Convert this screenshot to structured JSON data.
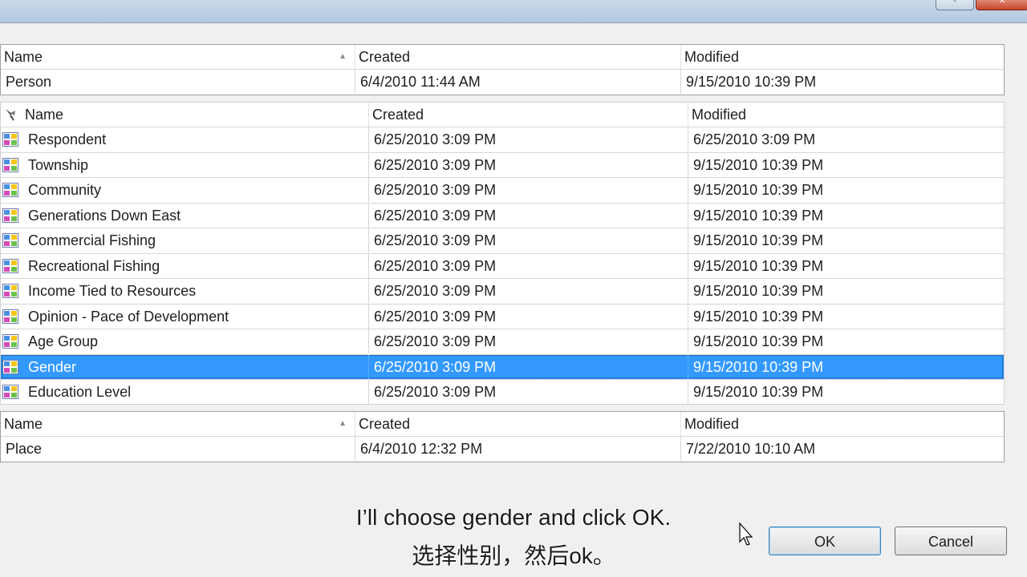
{
  "columns": {
    "name": "Name",
    "created": "Created",
    "modified": "Modified"
  },
  "person_table": {
    "rows": [
      {
        "name": "Person",
        "created": "6/4/2010 11:44 AM",
        "modified": "9/15/2010 10:39 PM"
      }
    ]
  },
  "attribute_table": {
    "rows": [
      {
        "name": "Respondent",
        "created": "6/25/2010 3:09 PM",
        "modified": "6/25/2010 3:09 PM"
      },
      {
        "name": "Township",
        "created": "6/25/2010 3:09 PM",
        "modified": "9/15/2010 10:39 PM"
      },
      {
        "name": "Community",
        "created": "6/25/2010 3:09 PM",
        "modified": "9/15/2010 10:39 PM"
      },
      {
        "name": "Generations Down East",
        "created": "6/25/2010 3:09 PM",
        "modified": "9/15/2010 10:39 PM"
      },
      {
        "name": "Commercial Fishing",
        "created": "6/25/2010 3:09 PM",
        "modified": "9/15/2010 10:39 PM"
      },
      {
        "name": "Recreational Fishing",
        "created": "6/25/2010 3:09 PM",
        "modified": "9/15/2010 10:39 PM"
      },
      {
        "name": "Income Tied to Resources",
        "created": "6/25/2010 3:09 PM",
        "modified": "9/15/2010 10:39 PM"
      },
      {
        "name": "Opinion - Pace of Development",
        "created": "6/25/2010 3:09 PM",
        "modified": "9/15/2010 10:39 PM"
      },
      {
        "name": "Age Group",
        "created": "6/25/2010 3:09 PM",
        "modified": "9/15/2010 10:39 PM"
      },
      {
        "name": "Gender",
        "created": "6/25/2010 3:09 PM",
        "modified": "9/15/2010 10:39 PM",
        "selected": true
      },
      {
        "name": "Education Level",
        "created": "6/25/2010 3:09 PM",
        "modified": "9/15/2010 10:39 PM"
      }
    ]
  },
  "place_table": {
    "rows": [
      {
        "name": "Place",
        "created": "6/4/2010 12:32 PM",
        "modified": "7/22/2010 10:10 AM"
      }
    ]
  },
  "icons": {
    "attribute": "attribute-grid-icon",
    "header_pin": "pin-icon",
    "colors": [
      "#4a90e2",
      "#f5c518",
      "#d64ab8",
      "#6cc24a"
    ]
  },
  "subtitles": {
    "english": "I’ll choose gender and click OK.",
    "chinese": "选择性别，然后ok。"
  },
  "buttons": {
    "ok": "OK",
    "cancel": "Cancel"
  },
  "colors": {
    "selection": "#3399ff",
    "selection_text": "#ffffff"
  }
}
